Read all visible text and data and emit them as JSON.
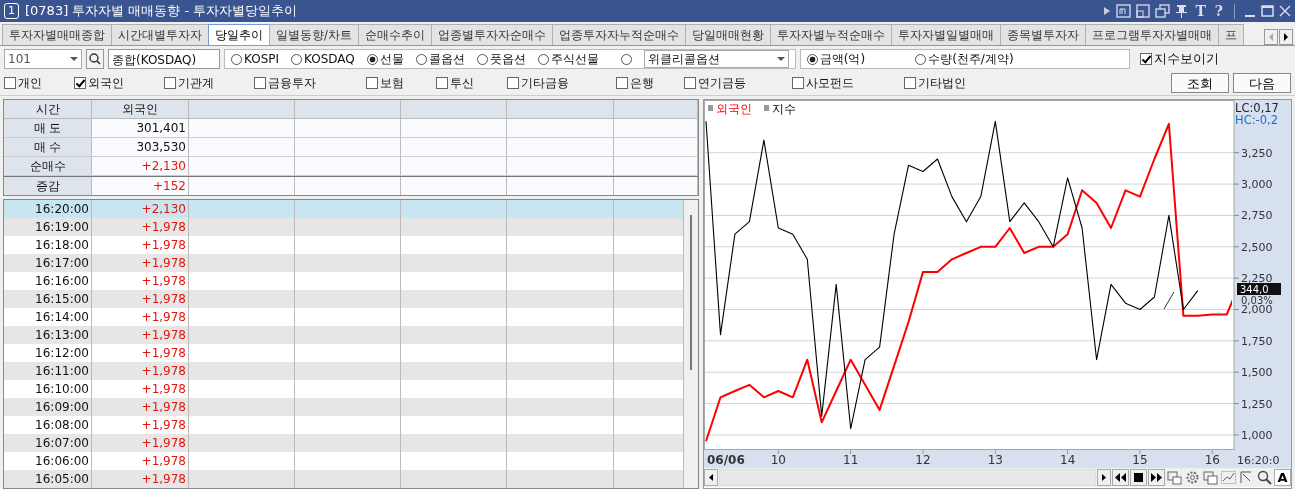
{
  "window": {
    "number": "1",
    "title": "[0783] 투자자별 매매동향 - 투자자별당일추이",
    "glyph_buttons": [
      "T",
      "?"
    ]
  },
  "tabs": [
    {
      "label": "투자자별매매종합",
      "selected": false
    },
    {
      "label": "시간대별투자자",
      "selected": false
    },
    {
      "label": "당일추이",
      "selected": true
    },
    {
      "label": "일별동향/차트",
      "selected": false
    },
    {
      "label": "순매수추이",
      "selected": false
    },
    {
      "label": "업종별투자자순매수",
      "selected": false
    },
    {
      "label": "업종투자자누적순매수",
      "selected": false
    },
    {
      "label": "당일매매현황",
      "selected": false
    },
    {
      "label": "투자자별누적순매수",
      "selected": false
    },
    {
      "label": "투자자별일별매매",
      "selected": false
    },
    {
      "label": "종목별투자자",
      "selected": false
    },
    {
      "label": "프로그램투자자별매매",
      "selected": false
    },
    {
      "label": "프",
      "selected": false
    }
  ],
  "query": {
    "code": "101",
    "name": "종합(KOSDAQ)",
    "market_options": [
      {
        "kind": "radio",
        "label": "KOSPI",
        "selected": false
      },
      {
        "kind": "radio",
        "label": "KOSDAQ",
        "selected": false
      },
      {
        "kind": "radio",
        "label": "선물",
        "selected": true
      },
      {
        "kind": "radio",
        "label": "콜옵션",
        "selected": false
      },
      {
        "kind": "radio",
        "label": "풋옵션",
        "selected": false
      },
      {
        "kind": "radio",
        "label": "주식선물",
        "selected": false
      },
      {
        "kind": "dropdown",
        "value": "위클리콜옵션",
        "selected": false
      }
    ],
    "unit_options": [
      {
        "label": "금액(억)",
        "selected": true
      },
      {
        "label": "수량(천주/계약)",
        "selected": false
      }
    ],
    "show_index": {
      "label": "지수보이기",
      "checked": true
    }
  },
  "investors": [
    {
      "label": "개인",
      "checked": false
    },
    {
      "label": "외국인",
      "checked": true
    },
    {
      "label": "기관계",
      "checked": false
    },
    {
      "label": "금융투자",
      "checked": false
    },
    {
      "label": "보험",
      "checked": false
    },
    {
      "label": "투신",
      "checked": false
    },
    {
      "label": "기타금융",
      "checked": false
    },
    {
      "label": "은행",
      "checked": false
    },
    {
      "label": "연기금등",
      "checked": false
    },
    {
      "label": "사모펀드",
      "checked": false
    },
    {
      "label": "기타법인",
      "checked": false
    }
  ],
  "buttons": [
    "조회",
    "다음"
  ],
  "summary": {
    "columns": [
      "시간",
      "외국인"
    ],
    "rows": [
      {
        "label": "매 도",
        "value": "301,401",
        "kind": "plain"
      },
      {
        "label": "매 수",
        "value": "303,530",
        "kind": "plain"
      },
      {
        "label": "순매수",
        "value": "+2,130",
        "kind": "up"
      },
      {
        "label": "증감",
        "value": "+152",
        "kind": "up"
      }
    ]
  },
  "timeline": [
    {
      "time": "16:20:00",
      "value": "+2,130",
      "kind": "up",
      "selected": true
    },
    {
      "time": "16:19:00",
      "value": "+1,978",
      "kind": "up",
      "selected": false
    },
    {
      "time": "16:18:00",
      "value": "+1,978",
      "kind": "up",
      "selected": false
    },
    {
      "time": "16:17:00",
      "value": "+1,978",
      "kind": "up",
      "selected": false
    },
    {
      "time": "16:16:00",
      "value": "+1,978",
      "kind": "up",
      "selected": false
    },
    {
      "time": "16:15:00",
      "value": "+1,978",
      "kind": "up",
      "selected": false
    },
    {
      "time": "16:14:00",
      "value": "+1,978",
      "kind": "up",
      "selected": false
    },
    {
      "time": "16:13:00",
      "value": "+1,978",
      "kind": "up",
      "selected": false
    },
    {
      "time": "16:12:00",
      "value": "+1,978",
      "kind": "up",
      "selected": false
    },
    {
      "time": "16:11:00",
      "value": "+1,978",
      "kind": "up",
      "selected": false
    },
    {
      "time": "16:10:00",
      "value": "+1,978",
      "kind": "up",
      "selected": false
    },
    {
      "time": "16:09:00",
      "value": "+1,978",
      "kind": "up",
      "selected": false
    },
    {
      "time": "16:08:00",
      "value": "+1,978",
      "kind": "up",
      "selected": false
    },
    {
      "time": "16:07:00",
      "value": "+1,978",
      "kind": "up",
      "selected": false
    },
    {
      "time": "16:06:00",
      "value": "+1,978",
      "kind": "up",
      "selected": false
    },
    {
      "time": "16:05:00",
      "value": "+1,978",
      "kind": "up",
      "selected": false
    }
  ],
  "chart": {
    "date_label": "06/06",
    "lc": "LC:0,17",
    "hc": "HC:-0,2",
    "price_tag": "344,0",
    "percent_tag": "0,03%",
    "time_end": "16:20:0",
    "tool_glyph": "A",
    "chart_data": {
      "type": "line",
      "x": [
        9.0,
        9.2,
        9.4,
        9.6,
        9.8,
        10.0,
        10.2,
        10.4,
        10.6,
        10.8,
        11.0,
        11.2,
        11.4,
        11.6,
        11.8,
        12.0,
        12.2,
        12.4,
        12.6,
        12.8,
        13.0,
        13.2,
        13.4,
        13.6,
        13.8,
        14.0,
        14.2,
        14.4,
        14.6,
        14.8,
        15.0,
        15.2,
        15.4,
        15.6,
        15.8,
        16.0,
        16.2,
        16.3
      ],
      "series": [
        {
          "name": "외국인",
          "color": "#ff0000",
          "values": [
            950,
            1300,
            1350,
            1400,
            1300,
            1350,
            1300,
            1600,
            1100,
            1350,
            1600,
            1400,
            1200,
            1550,
            1900,
            2300,
            2300,
            2400,
            2450,
            2500,
            2500,
            2650,
            2450,
            2500,
            2500,
            2600,
            2950,
            2850,
            2650,
            2950,
            2900,
            3200,
            3480,
            1950,
            1950,
            1960,
            1960,
            2100
          ]
        },
        {
          "name": "지수",
          "color": "#000000",
          "values": [
            3500,
            1800,
            2600,
            2700,
            3350,
            2650,
            2600,
            2400,
            1150,
            2200,
            1050,
            1600,
            1700,
            2600,
            3150,
            3100,
            3200,
            2900,
            2700,
            2900,
            3500,
            2700,
            2850,
            2700,
            2500,
            3050,
            2650,
            1600,
            2200,
            2050,
            2000,
            2100,
            2750,
            2000,
            2150,
            null,
            null,
            null
          ]
        }
      ],
      "grid": true,
      "xlim": [
        9,
        16.3
      ],
      "ylim": [
        880,
        3670
      ],
      "xticks": [
        10,
        11,
        12,
        13,
        14,
        15,
        16
      ],
      "yticks": [
        {
          "value": 3250,
          "label": "3,250"
        },
        {
          "value": 3000,
          "label": "3,000"
        },
        {
          "value": 2750,
          "label": "2,750"
        },
        {
          "value": 2500,
          "label": "2,500"
        },
        {
          "value": 2250,
          "label": "2,250"
        },
        {
          "value": 2000,
          "label": "2,000"
        },
        {
          "value": 1750,
          "label": "1,750"
        },
        {
          "value": 1500,
          "label": "1,500"
        },
        {
          "value": 1250,
          "label": "1,250"
        },
        {
          "value": 1000,
          "label": "1,000"
        }
      ]
    }
  }
}
